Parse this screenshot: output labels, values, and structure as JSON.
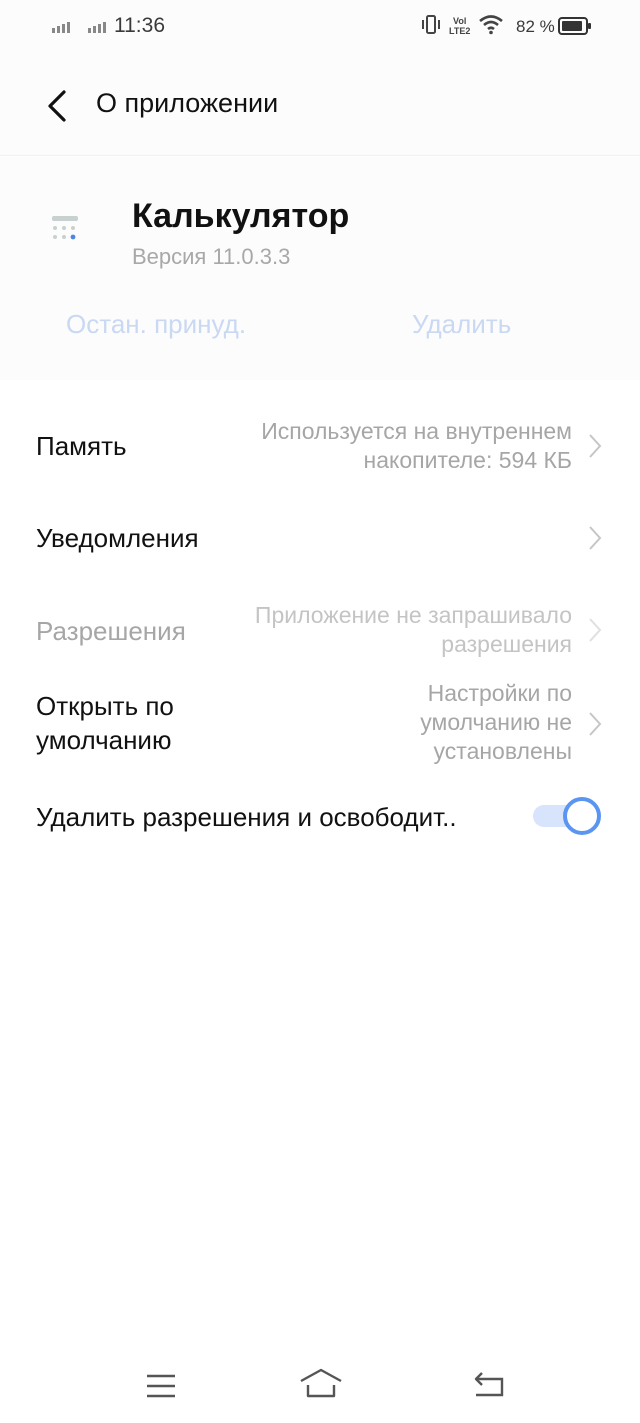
{
  "status_bar": {
    "time": "11:36",
    "lte_top": "Vol",
    "lte_bottom": "LTE2",
    "battery": "82 %",
    "icons": [
      "signal-icon",
      "signal-icon",
      "vibrate-icon",
      "volte-icon",
      "wifi-icon",
      "battery-icon"
    ]
  },
  "header": {
    "title": "О приложении",
    "back_icon": "chevron-left-icon"
  },
  "app": {
    "name": "Калькулятор",
    "version": "Версия 11.0.3.3",
    "icon": "calculator-icon",
    "force_stop_label": "Остан. принуд.",
    "uninstall_label": "Удалить",
    "accent": "#c9d8f3"
  },
  "settings": {
    "memory": {
      "label": "Память",
      "value_line1": "Используется на внутреннем",
      "value_line2": "накопителе: 594 КБ"
    },
    "notifications": {
      "label": "Уведомления"
    },
    "permissions": {
      "label": "Разрешения",
      "value_line1": "Приложение не запрашивало",
      "value_line2": "разрешения"
    },
    "open_default": {
      "label_line1": "Открыть по",
      "label_line2": "умолчанию",
      "value_line1": "Настройки по",
      "value_line2": "умолчанию не",
      "value_line3": "установлены"
    },
    "remove_permissions": {
      "label": "Удалить разрешения и освободит..",
      "enabled": true,
      "toggle_color": "#5a95f2"
    }
  },
  "nav_bar": {
    "icons": [
      "menu-icon",
      "home-icon",
      "back-icon"
    ]
  }
}
